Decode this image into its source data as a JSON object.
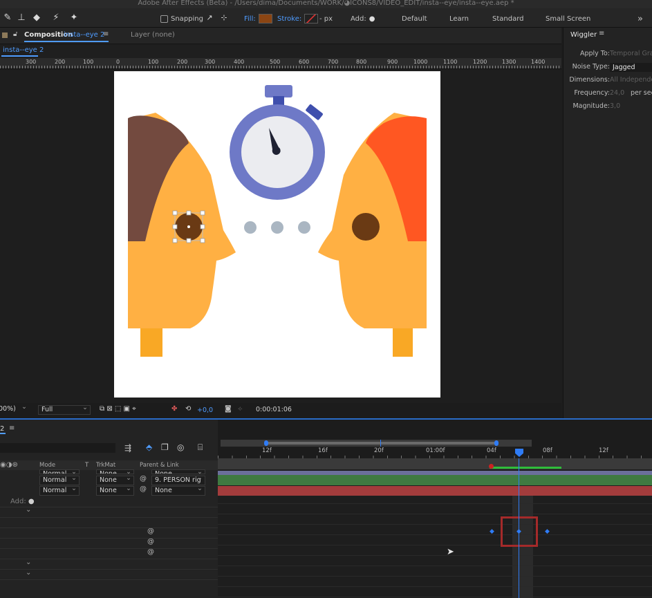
{
  "app_title": "Adobe After Effects (Beta) - /Users/dima/Documents/WORK/◕ICONS8/VIDEO_EDIT/insta--eye/insta--eye.aep *",
  "toolbar": {
    "snapping_label": "Snapping",
    "fill_label": "Fill:",
    "stroke_label": "Stroke:",
    "stroke_px": "- px",
    "add_label": "Add:",
    "workspaces": [
      "Default",
      "Learn",
      "Standard",
      "Small Screen"
    ],
    "fill_color": "#8b4513",
    "more_label": "»"
  },
  "comp_panel": {
    "tab_label": "Composition",
    "comp_name": "insta--eye 2",
    "layer_tab": "Layer (none)",
    "sub_tab": "insta--eye 2",
    "ruler_labels": [
      "300",
      "200",
      "100",
      "0",
      "100",
      "200",
      "300",
      "400",
      "500",
      "600",
      "700",
      "800",
      "900",
      "1000",
      "1100",
      "1200",
      "1300",
      "1400"
    ],
    "zoom": "00%)",
    "resolution": "Full",
    "exposure": "+0,0",
    "timecode": "0:00:01:06"
  },
  "effect_panel": {
    "title": "Wiggler",
    "rows": [
      {
        "label": "Apply To:",
        "value": "Temporal Graph"
      },
      {
        "label": "Noise Type:",
        "value": "Jagged"
      },
      {
        "label": "Dimensions:",
        "value": "All Independently"
      },
      {
        "label": "Frequency:",
        "value": "24,0",
        "unit": "per second"
      },
      {
        "label": "Magnitude:",
        "value": "3,0"
      }
    ]
  },
  "timeline": {
    "tab_num": "2",
    "columns": {
      "mode": "Mode",
      "t": "T",
      "trkmat": "TrkMat",
      "parent": "Parent & Link"
    },
    "rows": [
      {
        "mode": "Normal",
        "trkmat": "None",
        "parent": "None"
      },
      {
        "mode": "Normal",
        "trkmat": "None",
        "parent": "9. PERSON rig"
      },
      {
        "mode": "Normal",
        "trkmat": "None",
        "parent": "None"
      }
    ],
    "add_label": "Add:",
    "time_labels": [
      "12f",
      "16f",
      "20f",
      "01:00f",
      "04f",
      "08f",
      "12f"
    ]
  },
  "colors": {
    "accent_blue": "#2f7cf6",
    "skin": "#ffb043",
    "hair_left": "#734a3f",
    "hair_right": "#ff5722",
    "eye": "#6a3a14",
    "stopwatch": "#6e79c7",
    "highlight_box": "#a52a2a"
  }
}
